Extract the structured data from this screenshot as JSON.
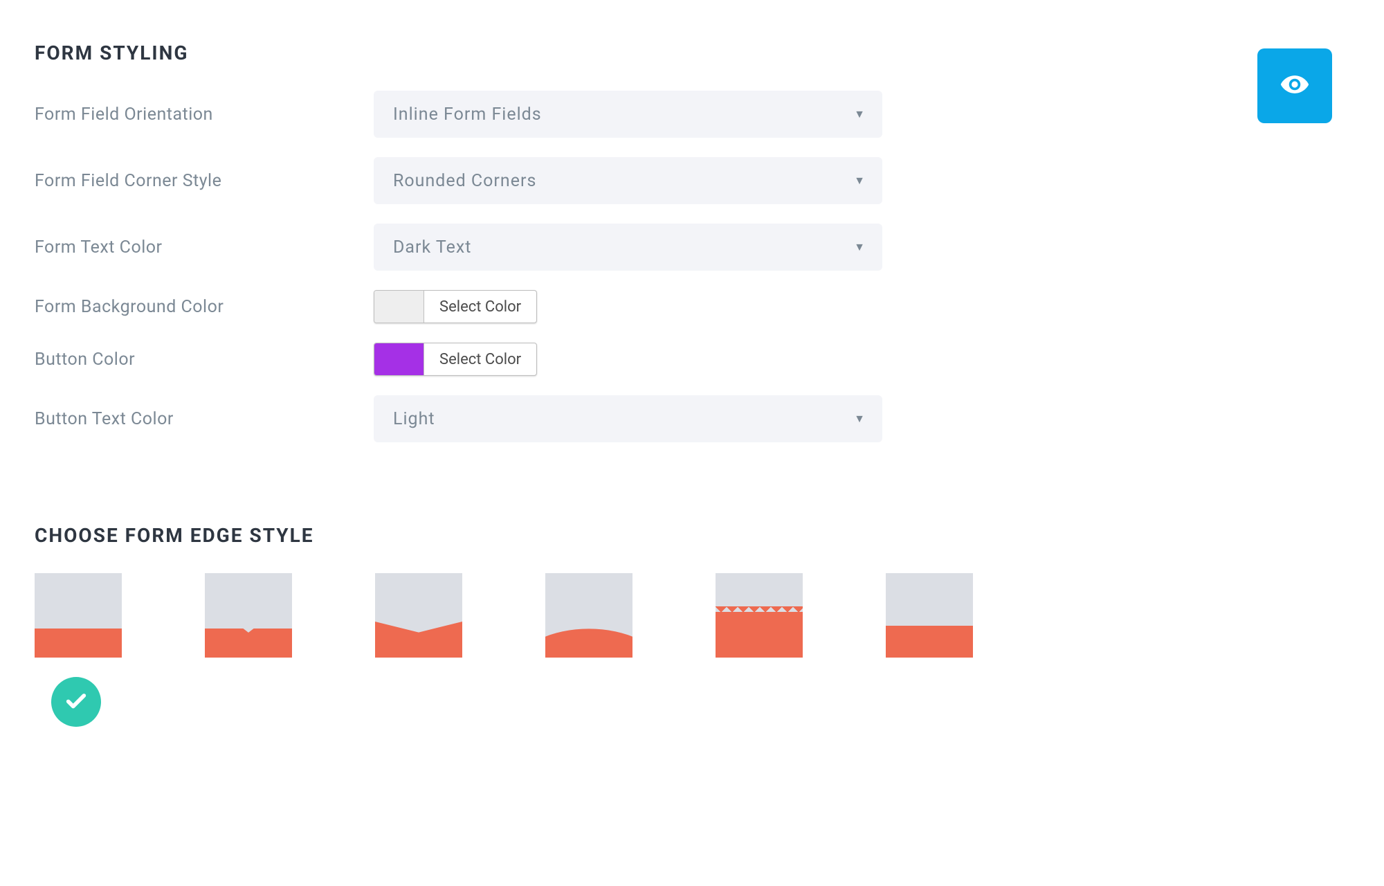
{
  "sections": {
    "formStyling": {
      "title": "FORM STYLING",
      "fields": {
        "orientation": {
          "label": "Form Field Orientation",
          "value": "Inline Form Fields"
        },
        "cornerStyle": {
          "label": "Form Field Corner Style",
          "value": "Rounded Corners"
        },
        "textColor": {
          "label": "Form Text Color",
          "value": "Dark Text"
        },
        "bgColor": {
          "label": "Form Background Color",
          "button": "Select Color",
          "swatch": "#eeeeee"
        },
        "buttonColor": {
          "label": "Button Color",
          "button": "Select Color",
          "swatch": "#a530e6"
        },
        "buttonTextColor": {
          "label": "Button Text Color",
          "value": "Light"
        }
      }
    },
    "edgeStyle": {
      "title": "CHOOSE FORM EDGE STYLE",
      "options": [
        "flat",
        "notch",
        "vshape",
        "curve",
        "zigzag",
        "flat2"
      ],
      "selectedIndex": 0
    }
  },
  "colors": {
    "edgeFill": "#ee6a50",
    "tileBg": "#dbdee4",
    "accentTeal": "#2fc9b0",
    "accentBlue": "#0aa7e8"
  }
}
